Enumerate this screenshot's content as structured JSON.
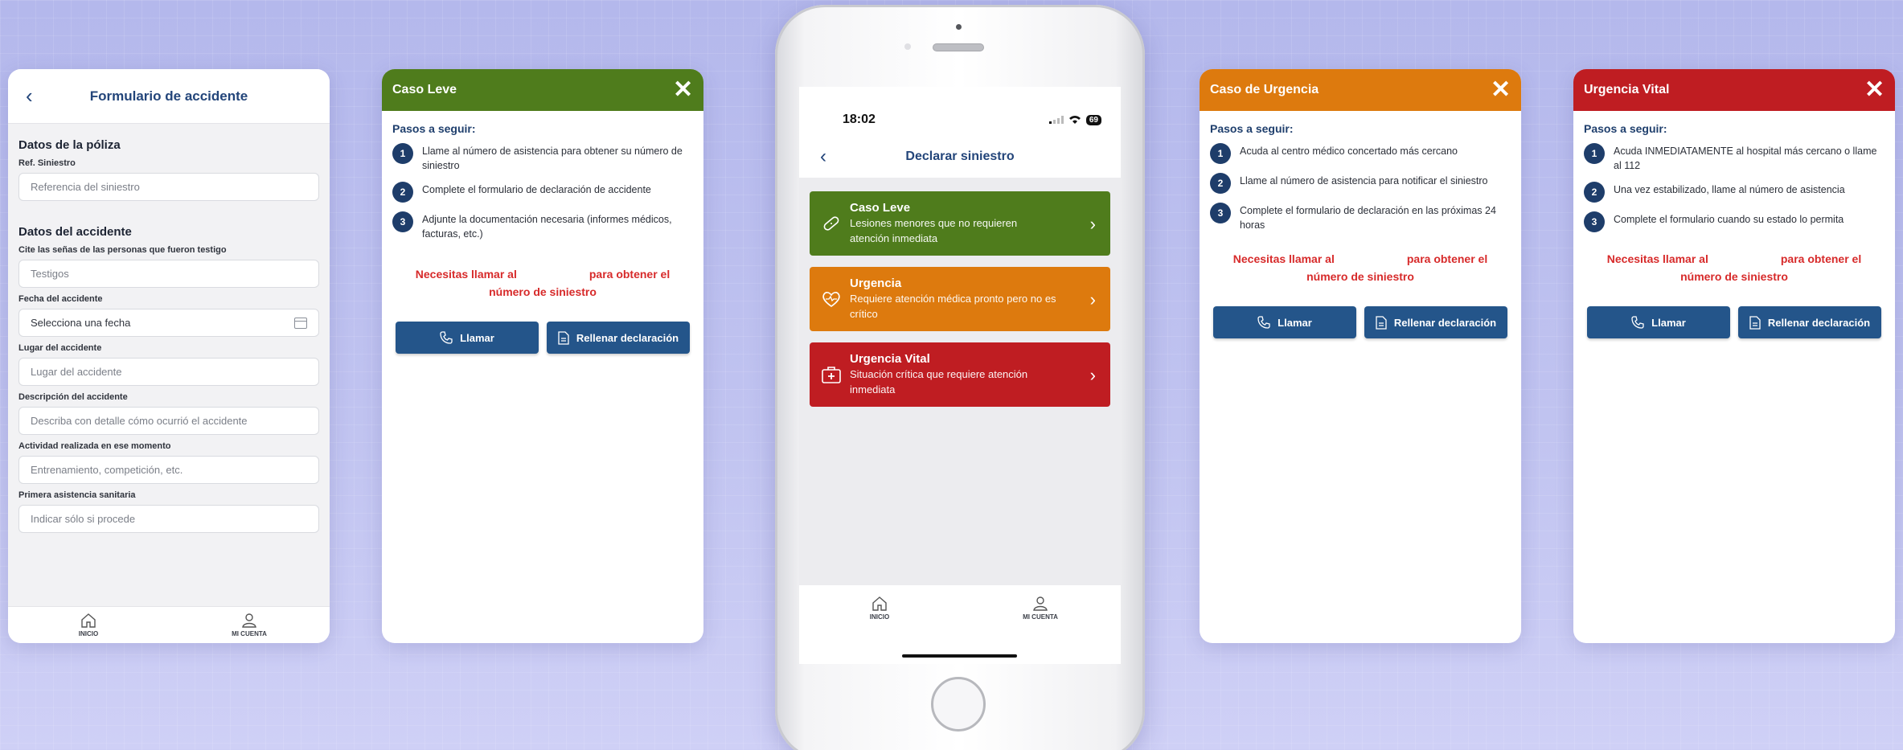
{
  "form": {
    "title": "Formulario de accidente",
    "section1": "Datos de la póliza",
    "ref_label": "Ref. Siniestro",
    "ref_placeholder": "Referencia del siniestro",
    "section2": "Datos del accidente",
    "witness_label": "Cite las señas de las personas que fueron testigo",
    "witness_placeholder": "Testigos",
    "date_label": "Fecha del accidente",
    "date_value": "Selecciona una fecha",
    "place_label": "Lugar del accidente",
    "place_placeholder": "Lugar del accidente",
    "desc_label": "Descripción del accidente",
    "desc_placeholder": "Describa con detalle cómo ocurrió el accidente",
    "activity_label": "Actividad realizada en ese momento",
    "activity_placeholder": "Entrenamiento, competición, etc.",
    "care_label": "Primera asistencia sanitaria",
    "care_placeholder": "Indicar sólo si procede"
  },
  "tabs": {
    "home": "INICIO",
    "account": "MI CUENTA"
  },
  "common": {
    "steps_title": "Pasos a seguir:",
    "notice_a": "Necesitas llamar al",
    "notice_b": "para obtener el",
    "notice_c": "número de siniestro",
    "call_btn": "Llamar",
    "fill_btn": "Rellenar declaración"
  },
  "leve": {
    "title": "Caso Leve",
    "color": "#4f7c1c",
    "steps": [
      "Llame al número de asistencia para obtener su número de siniestro",
      "Complete el formulario de declaración de accidente",
      "Adjunte la documentación necesaria (informes médicos, facturas, etc.)"
    ]
  },
  "urgencia": {
    "title": "Caso de Urgencia",
    "color": "#dd7a0e",
    "steps": [
      "Acuda al centro médico concertado más cercano",
      "Llame al número de asistencia para notificar el siniestro",
      "Complete el formulario de declaración en las próximas 24 horas"
    ]
  },
  "vital": {
    "title": "Urgencia Vital",
    "color": "#bf1d22",
    "steps": [
      "Acuda INMEDIATAMENTE al hospital más cercano o llame al 112",
      "Una vez estabilizado, llame al número de asistencia",
      "Complete el formulario cuando su estado lo permita"
    ]
  },
  "phone": {
    "time": "18:02",
    "battery": "69",
    "title": "Declarar siniestro",
    "options": [
      {
        "title": "Caso Leve",
        "desc": "Lesiones menores que no requieren atención inmediata",
        "color": "#4f7c1c",
        "icon": "bandage-icon"
      },
      {
        "title": "Urgencia",
        "desc": "Requiere atención médica pronto pero no es crítico",
        "color": "#dd7a0e",
        "icon": "heart-pulse-icon"
      },
      {
        "title": "Urgencia Vital",
        "desc": "Situación crítica que requiere atención inmediata",
        "color": "#bf1d22",
        "icon": "medical-kit-icon"
      }
    ]
  }
}
